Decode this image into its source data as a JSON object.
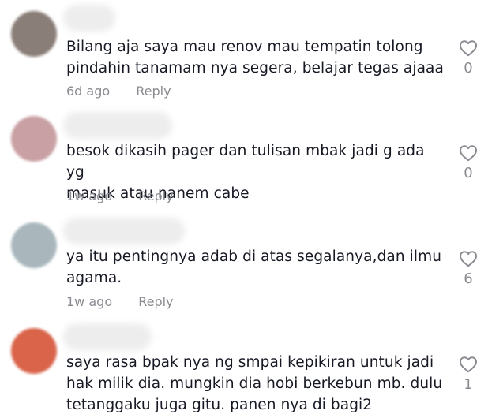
{
  "comments": [
    {
      "avatar_color": "#8a7e78",
      "text": "Bilang aja saya mau renov mau tempatin tolong\npindahin tanamam nya segera, belajar tegas ajaaa",
      "time": "6d ago",
      "reply_label": "Reply",
      "likes": "0",
      "like_icon": "heart-outline-icon"
    },
    {
      "avatar_color": "#c9a0a3",
      "text": "besok dikasih pager dan tulisan mbak jadi g ada yg\nmasuk atau nanem cabe",
      "time": "1w ago",
      "reply_label": "Reply",
      "likes": "0",
      "like_icon": "heart-outline-icon"
    },
    {
      "avatar_color": "#a9b7bd",
      "text": "ya itu pentingnya adab di atas segalanya,dan ilmu\nagama.",
      "time": "1w ago",
      "reply_label": "Reply",
      "likes": "6",
      "like_icon": "heart-outline-icon"
    },
    {
      "avatar_color": "#d9644a",
      "text": "saya rasa bpak nya ng smpai kepikiran untuk jadi\nhak milik dia. mungkin dia hobi berkebun mb. dulu\ntetanggaku juga gitu. panen nya di bagi2",
      "time": "",
      "reply_label": "",
      "likes": "1",
      "like_icon": "heart-outline-icon"
    }
  ]
}
